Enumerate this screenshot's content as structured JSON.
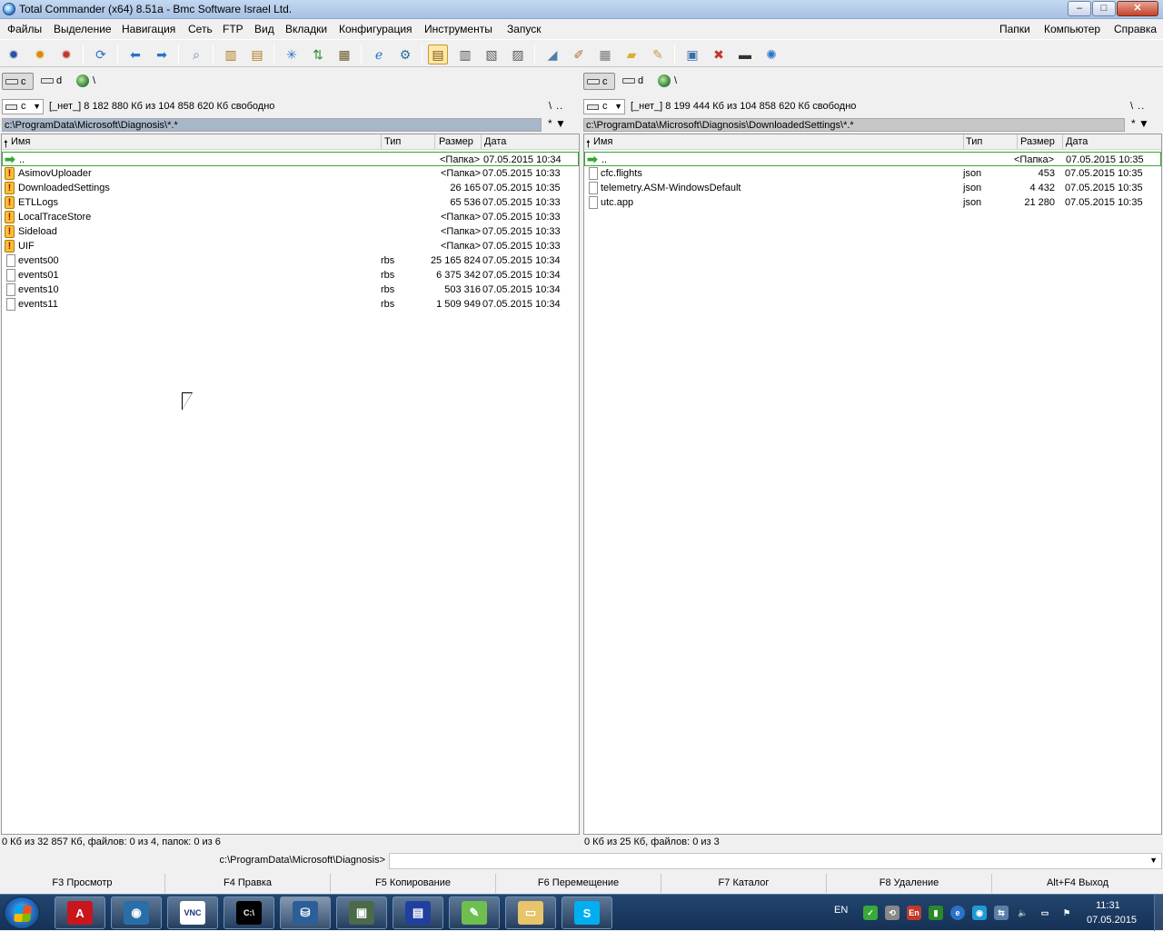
{
  "window": {
    "title": "Total Commander (x64) 8.51a - Bmc Software Israel Ltd.",
    "min": "–",
    "max": "□",
    "close": "✕"
  },
  "menu": {
    "left": [
      "Файлы",
      "Выделение",
      "Навигация",
      "Сеть",
      "FTP",
      "Вид",
      "Вкладки",
      "Конфигурация",
      "Инструменты",
      "Запуск"
    ],
    "right": [
      "Папки",
      "Компьютер",
      "Справка"
    ]
  },
  "toolbar": {
    "icons": [
      "gear-icon",
      "gear-orange-icon",
      "gear-red-icon",
      "refresh-icon",
      "back-icon",
      "forward-icon",
      "find-icon",
      "pack-icon",
      "unpack-icon",
      "tree-icon",
      "sort-icon",
      "notepad-icon",
      "ie-icon",
      "network-icon",
      "view-brief-icon",
      "view-full-icon",
      "view-thumbs-icon",
      "view-tree-icon",
      "copy-names-icon",
      "multi-rename-icon",
      "calc-icon",
      "note-icon",
      "edit-icon",
      "control-panel-icon",
      "kill-process-icon",
      "cmd-icon",
      "settings-icon"
    ]
  },
  "left": {
    "drives": {
      "d1": "c",
      "d2": "d",
      "d3": "\\"
    },
    "drive_select": "c",
    "free": "[_нет_]  8 182 880 Кб из 104 858 620 Кб свободно",
    "root_btns": "\\  ..",
    "path": "c:\\ProgramData\\Microsoft\\Diagnosis\\*.*",
    "path_btns": "*  ▼",
    "headers": {
      "name": "Имя",
      "ext": "Тип",
      "size": "Размер",
      "date": "Дата"
    },
    "rows": [
      {
        "icon": "up",
        "name": "..",
        "ext": "",
        "size": "<Папка>",
        "date": "07.05.2015 10:34"
      },
      {
        "icon": "warn",
        "name": "AsimovUploader",
        "ext": "",
        "size": "<Папка>",
        "date": "07.05.2015 10:33"
      },
      {
        "icon": "warn",
        "name": "DownloadedSettings",
        "ext": "",
        "size": "26 165",
        "date": "07.05.2015 10:35"
      },
      {
        "icon": "warn",
        "name": "ETLLogs",
        "ext": "",
        "size": "65 536",
        "date": "07.05.2015 10:33"
      },
      {
        "icon": "warn",
        "name": "LocalTraceStore",
        "ext": "",
        "size": "<Папка>",
        "date": "07.05.2015 10:33"
      },
      {
        "icon": "warn",
        "name": "Sideload",
        "ext": "",
        "size": "<Папка>",
        "date": "07.05.2015 10:33"
      },
      {
        "icon": "warn",
        "name": "UIF",
        "ext": "",
        "size": "<Папка>",
        "date": "07.05.2015 10:33"
      },
      {
        "icon": "file",
        "name": "events00",
        "ext": "rbs",
        "size": "25 165 824",
        "date": "07.05.2015 10:34"
      },
      {
        "icon": "file",
        "name": "events01",
        "ext": "rbs",
        "size": "6 375 342",
        "date": "07.05.2015 10:34"
      },
      {
        "icon": "file",
        "name": "events10",
        "ext": "rbs",
        "size": "503 316",
        "date": "07.05.2015 10:34"
      },
      {
        "icon": "file",
        "name": "events11",
        "ext": "rbs",
        "size": "1 509 949",
        "date": "07.05.2015 10:34"
      }
    ],
    "status": "0 Кб из 32 857 Кб, файлов: 0 из 4, папок: 0 из 6"
  },
  "right": {
    "drives": {
      "d1": "c",
      "d2": "d",
      "d3": "\\"
    },
    "drive_select": "c",
    "free": "[_нет_]  8 199 444 Кб из 104 858 620 Кб свободно",
    "root_btns": "\\  ..",
    "path": "c:\\ProgramData\\Microsoft\\Diagnosis\\DownloadedSettings\\*.*",
    "path_btns": "*  ▼",
    "headers": {
      "name": "Имя",
      "ext": "Тип",
      "size": "Размер",
      "date": "Дата"
    },
    "rows": [
      {
        "icon": "up",
        "name": "..",
        "ext": "",
        "size": "<Папка>",
        "date": "07.05.2015 10:35"
      },
      {
        "icon": "file",
        "name": "cfc.flights",
        "ext": "json",
        "size": "453",
        "date": "07.05.2015 10:35"
      },
      {
        "icon": "file",
        "name": "telemetry.ASM-WindowsDefault",
        "ext": "json",
        "size": "4 432",
        "date": "07.05.2015 10:35"
      },
      {
        "icon": "file",
        "name": "utc.app",
        "ext": "json",
        "size": "21 280",
        "date": "07.05.2015 10:35"
      }
    ],
    "status": "0 Кб из 25 Кб, файлов: 0 из 3"
  },
  "cmdline": {
    "path": "c:\\ProgramData\\Microsoft\\Diagnosis>"
  },
  "fkeys": [
    "F3 Просмотр",
    "F4 Правка",
    "F5 Копирование",
    "F6 Перемещение",
    "F7 Каталог",
    "F8 Удаление",
    "Alt+F4 Выход"
  ],
  "taskbar": {
    "apps": [
      {
        "name": "acrobat-icon",
        "glyph": "A",
        "color": "#c8161d"
      },
      {
        "name": "webcam-icon",
        "glyph": "◉",
        "color": "#2a6ea8"
      },
      {
        "name": "vnc-icon",
        "glyph": "VNC",
        "color": "#ffffff"
      },
      {
        "name": "cmd-icon",
        "glyph": "C:\\",
        "color": "#000000"
      },
      {
        "name": "total-commander-icon",
        "glyph": "⛁",
        "color": "#2c5f99"
      },
      {
        "name": "remote-icon",
        "glyph": "▣",
        "color": "#4a6a4a"
      },
      {
        "name": "floppy-icon",
        "glyph": "▤",
        "color": "#2040a0"
      },
      {
        "name": "notepad-icon",
        "glyph": "✎",
        "color": "#6fbf4f"
      },
      {
        "name": "explorer-icon",
        "glyph": "▭",
        "color": "#e8c46a"
      },
      {
        "name": "skype-icon",
        "glyph": "S",
        "color": "#00aff0"
      }
    ],
    "lang": "EN",
    "time": "11:31",
    "date": "07.05.2015"
  }
}
